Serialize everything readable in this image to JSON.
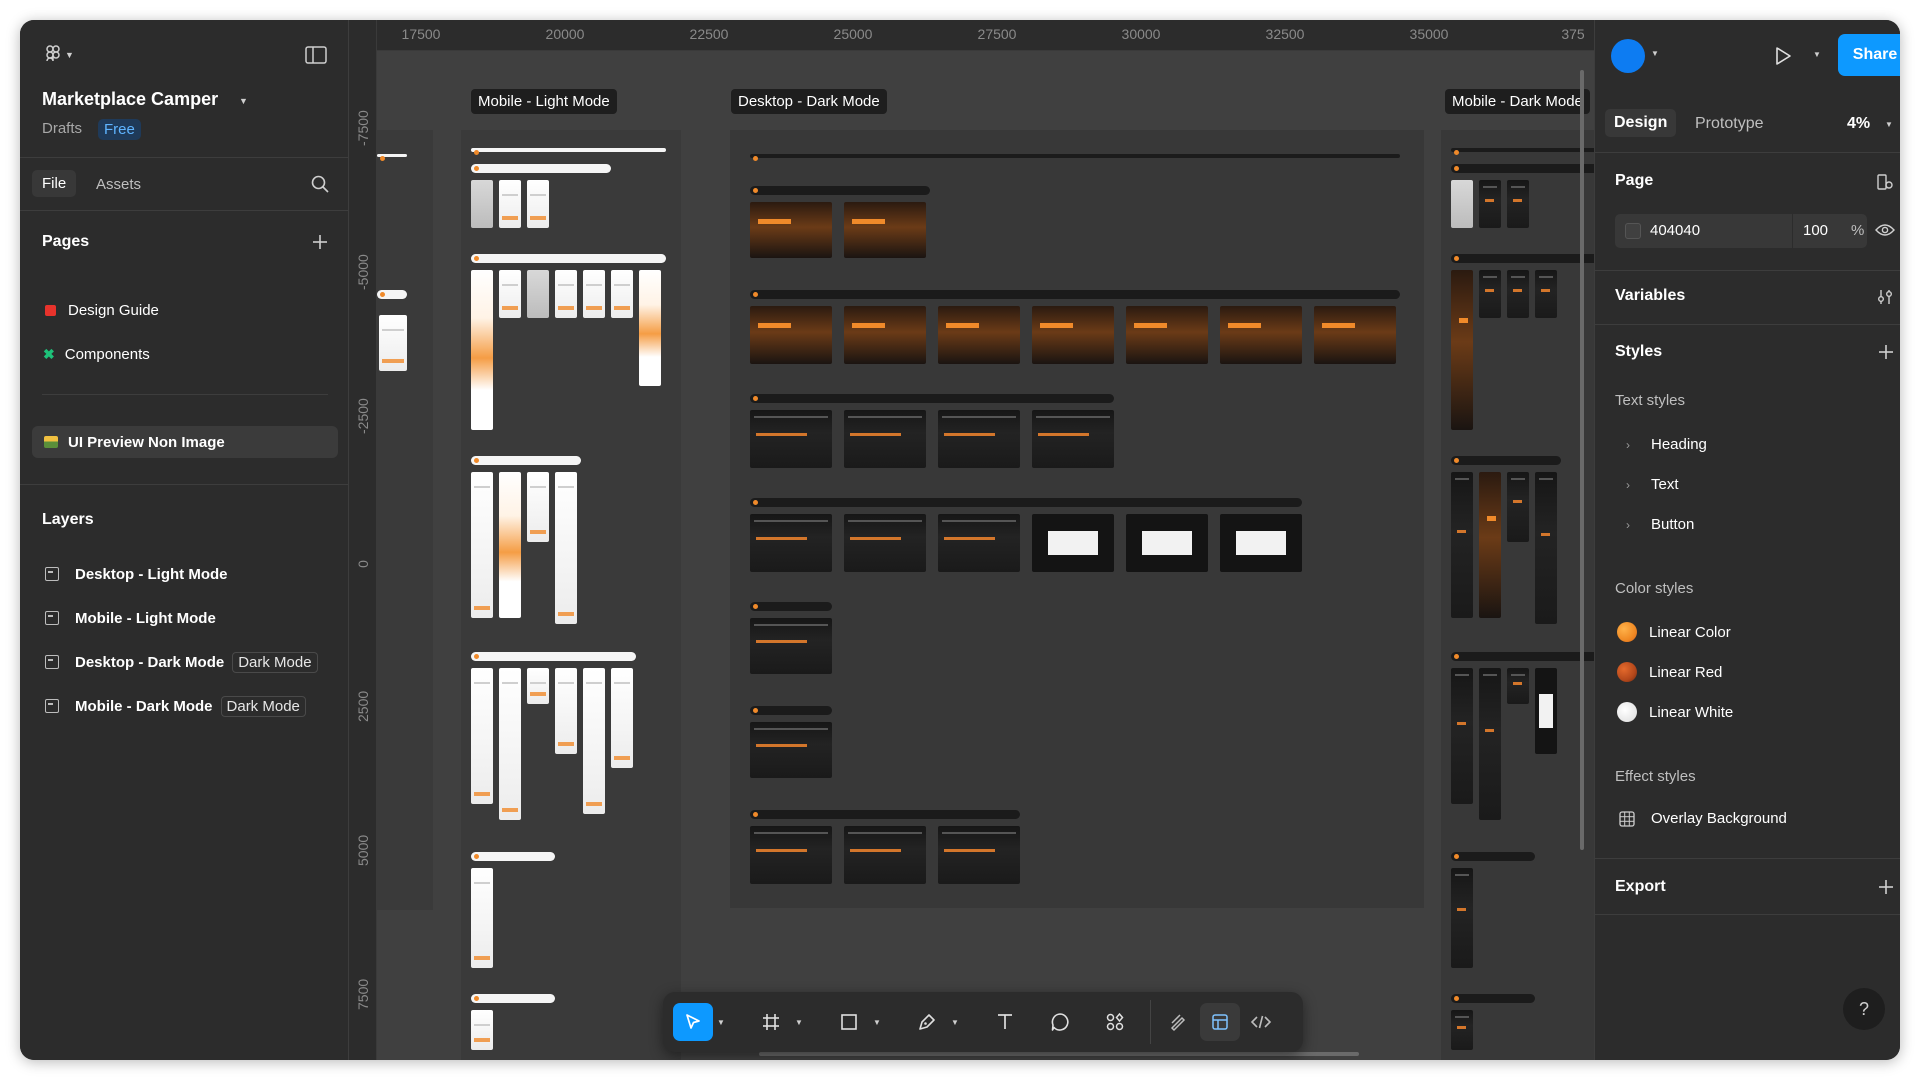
{
  "app": {
    "file_name": "Marketplace Camper",
    "location": "Drafts",
    "plan_badge": "Free"
  },
  "left_tabs": {
    "file": "File",
    "assets": "Assets"
  },
  "pages": {
    "title": "Pages",
    "items": [
      {
        "label": "Design Guide",
        "color": "#e8332c"
      },
      {
        "label": "Components",
        "color": "#1ec27a"
      }
    ],
    "current": {
      "label": "UI Preview Non Image"
    }
  },
  "layers": {
    "title": "Layers",
    "items": [
      {
        "label": "Desktop - Light Mode",
        "tag": ""
      },
      {
        "label": "Mobile - Light Mode",
        "tag": ""
      },
      {
        "label": "Desktop - Dark Mode",
        "tag": "Dark Mode"
      },
      {
        "label": "Mobile - Dark Mode",
        "tag": "Dark Mode"
      }
    ]
  },
  "canvas": {
    "background": "#404040",
    "ruler_top": [
      "17500",
      "20000",
      "22500",
      "25000",
      "27500",
      "30000",
      "32500",
      "35000",
      "375"
    ],
    "ruler_left": [
      "-7500",
      "-5000",
      "-2500",
      "0",
      "2500",
      "5000",
      "7500"
    ],
    "frame_labels": {
      "mobile_light": "Mobile - Light Mode",
      "desktop_dark": "Desktop - Dark Mode",
      "mobile_dark": "Mobile - Dark Mode"
    }
  },
  "toolbar": {
    "tools": [
      "move-tool",
      "frame-tool",
      "shape-tool",
      "pen-tool",
      "text-tool",
      "comment-tool",
      "actions-tool",
      "draw-mode",
      "design-mode",
      "dev-mode"
    ],
    "active_tool": "move-tool"
  },
  "right_panel": {
    "tabs": {
      "design": "Design",
      "prototype": "Prototype"
    },
    "zoom": "4%",
    "share_label": "Share",
    "page": {
      "title": "Page",
      "bg_hex": "404040",
      "opacity": "100",
      "opacity_unit": "%"
    },
    "variables_title": "Variables",
    "styles": {
      "title": "Styles",
      "text_styles_title": "Text styles",
      "text_styles": [
        "Heading",
        "Text",
        "Button"
      ],
      "color_styles_title": "Color styles",
      "color_styles": [
        {
          "label": "Linear Color",
          "color": "#f08a24"
        },
        {
          "label": "Linear Red",
          "color": "#b5481b"
        },
        {
          "label": "Linear White",
          "color": "#f2f2f2"
        }
      ],
      "effect_styles_title": "Effect styles",
      "effect_styles": [
        "Overlay Background"
      ]
    },
    "export_title": "Export",
    "help_label": "?"
  },
  "colors": {
    "accent": "#0d99ff",
    "panel_bg": "#2c2c2c",
    "brand_orange": "#f08a2a"
  }
}
